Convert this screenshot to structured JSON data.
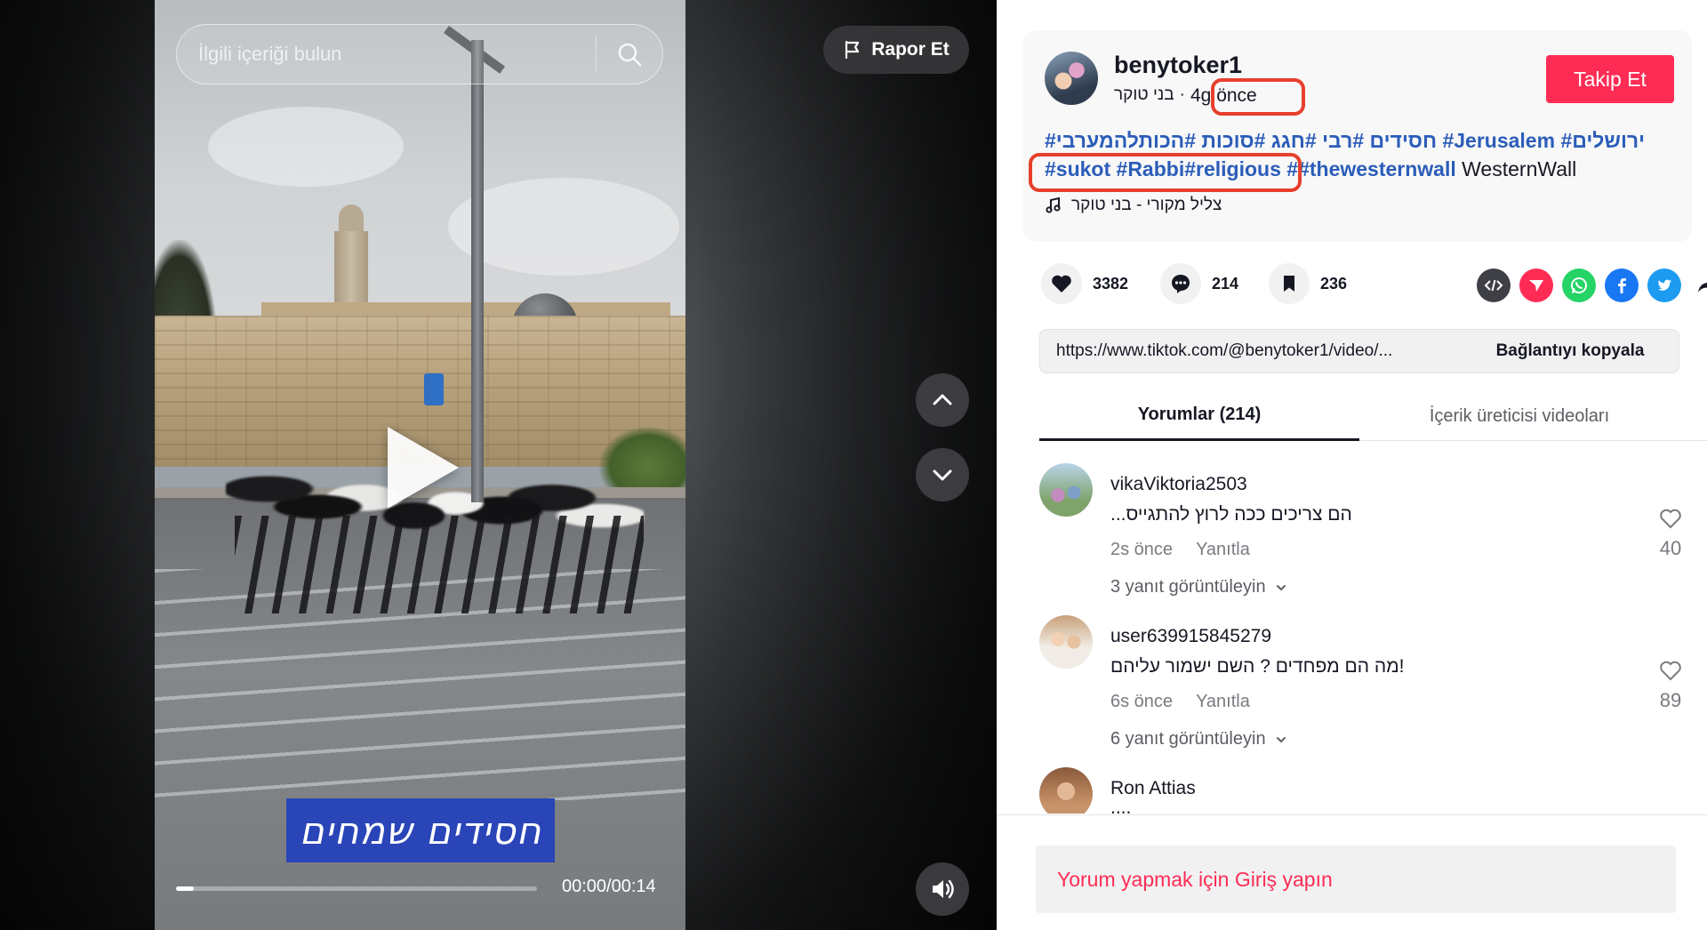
{
  "video": {
    "search_placeholder": "İlgili içeriği bulun",
    "report_label": "Rapor Et",
    "caption": "חסידים שמחים",
    "time": "00:00/00:14",
    "progress_fraction": 0.05
  },
  "post": {
    "username": "benytoker1",
    "display_name": "בני טוקר",
    "separator": "·",
    "time_ago": "4g önce",
    "follow_label": "Takip Et",
    "hashtags_line1": [
      "#חסידים",
      "#רבי",
      "#חגג",
      "#סוכות",
      "#הכותלהמערבי",
      "#Jerusalem",
      "#ירושלים"
    ],
    "hashtags_line2": [
      "#sukot",
      "#Rabbi",
      "#religious",
      "#",
      "#thewesternwall"
    ],
    "plain_word": "WesternWall",
    "music": "צליל מקורי - בני טוקר"
  },
  "stats": {
    "likes": "3382",
    "comments": "214",
    "saves": "236"
  },
  "share": {
    "link": "https://www.tiktok.com/@benytoker1/video/...",
    "copy_label": "Bağlantıyı kopyala",
    "icons": [
      "embed-icon",
      "send-icon",
      "whatsapp-icon",
      "facebook-icon",
      "twitter-icon",
      "share-arrow-icon"
    ]
  },
  "tabs": {
    "comments": "Yorumlar (214)",
    "creator_videos": "İçerik üreticisi videoları"
  },
  "comments": [
    {
      "name": "vikaViktoria2503",
      "text": "הם צריכים ככה לרוץ להתגייס...",
      "time": "2s önce",
      "reply": "Yanıtla",
      "likes": "40",
      "view_replies": "3 yanıt görüntüleyin"
    },
    {
      "name": "user639915845279",
      "text": "!מה הם מפחדים ? השם ישמור עליהם",
      "time": "6s önce",
      "reply": "Yanıtla",
      "likes": "89",
      "view_replies": "6 yanıt görüntüleyin"
    },
    {
      "name": "Ron Attias",
      "text": "!!!!",
      "time": "",
      "reply": "",
      "likes": "",
      "view_replies": ""
    }
  ],
  "login_prompt": "Yorum yapmak için Giriş yapın",
  "colors": {
    "brand_red": "#fe2c55",
    "hashtag_blue": "#2b5db9",
    "annotation_red": "#e6402d"
  }
}
